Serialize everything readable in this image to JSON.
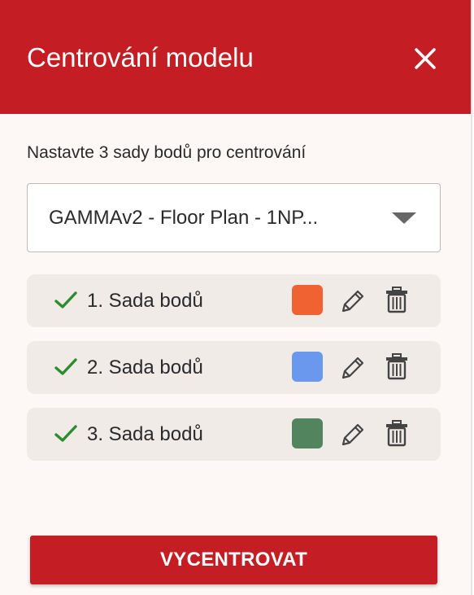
{
  "dialog": {
    "title": "Centrování modelu",
    "close_icon": "close-icon"
  },
  "instruction": "Nastavte 3 sady bodů pro centrování",
  "model_select": {
    "value": "GAMMAv2 - Floor Plan - 1NP...",
    "icon": "chevron-down-icon"
  },
  "point_sets": [
    {
      "label": "1. Sada bodů",
      "color": "#f06232",
      "status": "check-icon"
    },
    {
      "label": "2. Sada bodů",
      "color": "#6b98ef",
      "status": "check-icon"
    },
    {
      "label": "3. Sada bodů",
      "color": "#52845e",
      "status": "check-icon"
    }
  ],
  "action_icons": {
    "edit": "pencil-icon",
    "delete": "trash-icon"
  },
  "primary_button": {
    "label": "VYCENTROVAT"
  },
  "colors": {
    "brand": "#c41e24",
    "background": "#fdf8f6",
    "row_background": "#f1ebe8",
    "check": "#2e8b2e"
  }
}
